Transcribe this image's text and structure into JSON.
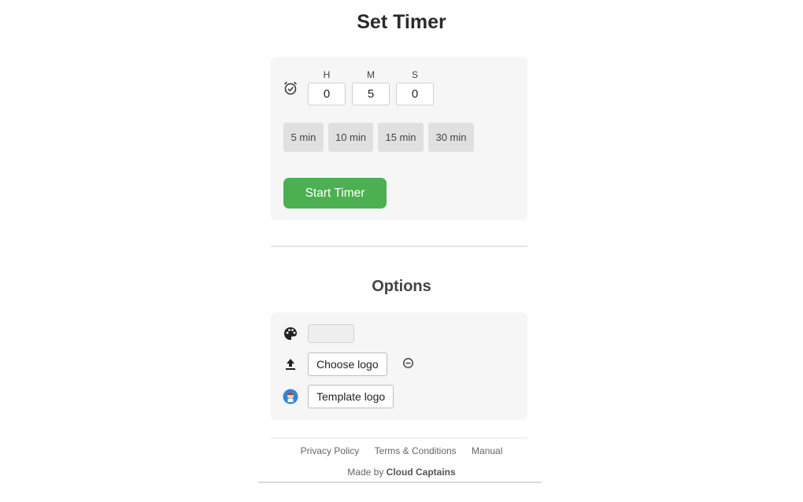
{
  "title": "Set Timer",
  "timer": {
    "labels": {
      "hours": "H",
      "minutes": "M",
      "seconds": "S"
    },
    "values": {
      "hours": "0",
      "minutes": "5",
      "seconds": "0"
    },
    "presets": [
      "5 min",
      "10 min",
      "15 min",
      "30 min"
    ],
    "start_label": "Start Timer",
    "accent_color": "#4caf50"
  },
  "options": {
    "title": "Options",
    "choose_logo_label": "Choose logo",
    "template_logo_label": "Template logo"
  },
  "footer": {
    "links": [
      "Privacy Policy",
      "Terms & Conditions",
      "Manual"
    ],
    "made_by_prefix": "Made by",
    "made_by_name": "Cloud Captains"
  },
  "icons": [
    "alarm-clock-icon",
    "palette-icon",
    "upload-icon",
    "remove-icon",
    "template-logo-icon"
  ]
}
